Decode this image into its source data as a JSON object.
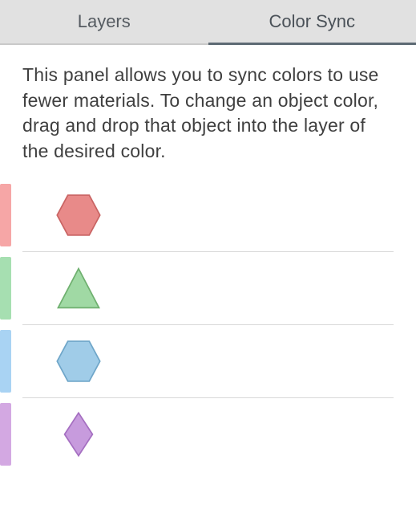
{
  "tabs": {
    "layers": {
      "label": "Layers"
    },
    "color_sync": {
      "label": "Color Sync"
    },
    "active": "color_sync"
  },
  "panel": {
    "description": "This panel allows you to sync colors to use fewer materials. To change an object color, drag and drop that object into the layer of the desired color."
  },
  "color_rows": [
    {
      "id": "row-pink",
      "swatch_color": "#f6a6a6",
      "shape": "hexagon",
      "shape_fill": "#e88a89",
      "shape_stroke": "#c96463"
    },
    {
      "id": "row-green",
      "swatch_color": "#a6dfb1",
      "shape": "triangle",
      "shape_fill": "#a0d9a4",
      "shape_stroke": "#6fb06f"
    },
    {
      "id": "row-blue",
      "swatch_color": "#a9d3f3",
      "shape": "hexagon",
      "shape_fill": "#a0cce8",
      "shape_stroke": "#6fa6c9"
    },
    {
      "id": "row-purple",
      "swatch_color": "#d3a8e2",
      "shape": "diamond",
      "shape_fill": "#c79bdd",
      "shape_stroke": "#a56fc1"
    }
  ]
}
